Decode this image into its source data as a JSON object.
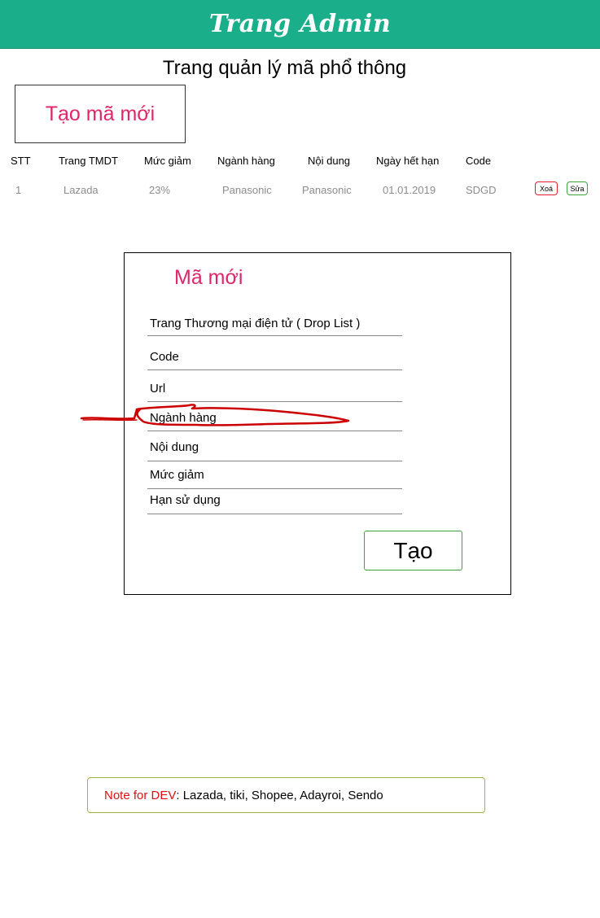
{
  "header": {
    "title": "Trang Admin"
  },
  "page_title": "Trang quản lý mã phổ thông",
  "create_code_button": "Tạo mã mới",
  "table": {
    "columns": [
      "STT",
      "Trang TMDT",
      "Mức giảm",
      "Ngành hàng",
      "Nội dung",
      "Ngày hết hạn",
      "Code"
    ],
    "rows": [
      {
        "cells": [
          "1",
          "Lazada",
          "23%",
          "Panasonic",
          "Panasonic",
          "01.01.2019",
          "SDGD"
        ],
        "delete_label": "Xoá",
        "edit_label": "Sửa"
      }
    ]
  },
  "modal": {
    "title": "Mã mới",
    "fields": [
      "Trang Thương mại điện tử ( Drop List )",
      "Code",
      "Url",
      "Ngành hàng",
      "Nội dung",
      "Mức giảm",
      "Hạn sử dụng"
    ],
    "submit_label": "Tạo"
  },
  "note": {
    "label": "Note for DEV",
    "text": ":  Lazada, tiki, Shopee, Adayroi, Sendo"
  },
  "colors": {
    "header_bg": "#1aaf8a",
    "accent_pink": "#e0256a",
    "delete_red": "#e0202a",
    "edit_green": "#3aa53a",
    "annotation_red": "#cc0000",
    "note_border": "#9ab33a"
  }
}
